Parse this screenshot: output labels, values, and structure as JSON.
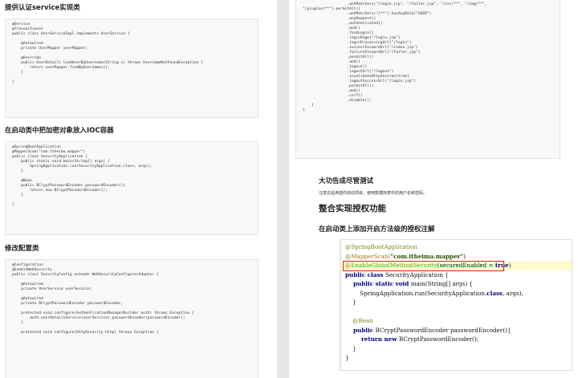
{
  "left": {
    "h1": "提供认证service实现类",
    "code1": [
      "@Service",
      "@Transactional",
      "public class UserServiceImpl implements UserService {",
      "",
      "    @Autowired",
      "    private UserMapper userMapper;",
      "",
      "    @Override",
      "    public UserDetails loadUserByUsername(String s) throws UsernameNotFoundException {",
      "        return userMapper.findByUsername(s);",
      "    }",
      "",
      "}"
    ],
    "h2": "在启动类中把加密对象放入IOC容器",
    "code2": [
      "@SpringBootApplication",
      "@MapperScan(\"com.itheima.mapper\")",
      "public class SecurityApplication {",
      "    public static void main(String[] args) {",
      "        SpringApplication.run(SecurityApplication.class, args);",
      "    }",
      "",
      "    @Bean",
      "    public BCryptPasswordEncoder passwordEncoder(){",
      "        return new BCryptPasswordEncoder();",
      "    }",
      "",
      "}"
    ],
    "h3": "修改配置类",
    "code3": [
      "@Configuration",
      "@EnableWebSecurity",
      "public class SecurityConfig extends WebSecurityConfigurerAdapter {",
      "",
      "    @Autowired",
      "    private UserService userService;",
      "",
      "    @Autowired",
      "    private BCryptPasswordEncoder passwordEncoder;",
      "",
      "    protected void configure(AuthenticationManagerBuilder auth) throws Exception {",
      "        auth.userDetailsService(userService).passwordEncoder(passwordEncoder);",
      "    }",
      "",
      "    protected void configure(HttpSecurity http) throws Exception {"
    ]
  },
  "right": {
    "code_top": [
      "                    .antMatchers(\"/login.jsp\", \"/failer.jsp\", \"/css/**\", \"/img/**\",",
      "\"/plugins/**\").permitAll()",
      "                    .antMatchers(\"/**\").hasAnyRole(\"USER\")",
      "                    .anyRequest()",
      "                    .authenticated()",
      "                    .and()",
      "                    .formLogin()",
      "                    .loginPage(\"/login.jsp\")",
      "                    .loginProcessingUrl(\"/login\")",
      "                    .successForwardUrl(\"/index.jsp\")",
      "                    .failureForwardUrl(\"/failer.jsp\")",
      "                    .permitAll()",
      "                    .and()",
      "                    .logout()",
      "                    .logoutUrl(\"/logout\")",
      "                    .invalidateHttpSession(true)",
      "                    .logoutSuccessUrl(\"/login.jsp\")",
      "                    .permitAll()",
      "                    .and()",
      "                    .csrf()",
      "                    .disable();",
      "    }",
      "}"
    ],
    "h1": "大功告成尽管测试",
    "note": "注意还是用插件启动项目，使用数据库表中的用户名和密码。",
    "h2": "整合实现授权功能",
    "h3": "在启动类上添加开启方法级的授权注解",
    "code2": {
      "l1": "@SpringBootApplication",
      "l2a": "@MapperScan(",
      "l2b": "\"com.itheima.mapper\"",
      "l2c": ")",
      "l3a": "@EnableGlobalMethodSecurity",
      "l3b": "(securedEnabled = ",
      "l3c": "true",
      "l3d": ")",
      "l4a": "public class ",
      "l4b": "SecurityApplication {",
      "l5a": "    public static void ",
      "l5b": "main(String[] args) {",
      "l6a": "        SpringApplication.run(SecurityApplication.",
      "l6b": "class",
      "l6c": ", args);",
      "l7": "    }",
      "l8": "",
      "l9": "    @Bean",
      "l10a": "    public ",
      "l10b": "BCryptPasswordEncoder passwordEncoder(){",
      "l11a": "        return new ",
      "l11b": "BCryptPasswordEncoder();",
      "l12": "    }",
      "l13": "}"
    }
  }
}
